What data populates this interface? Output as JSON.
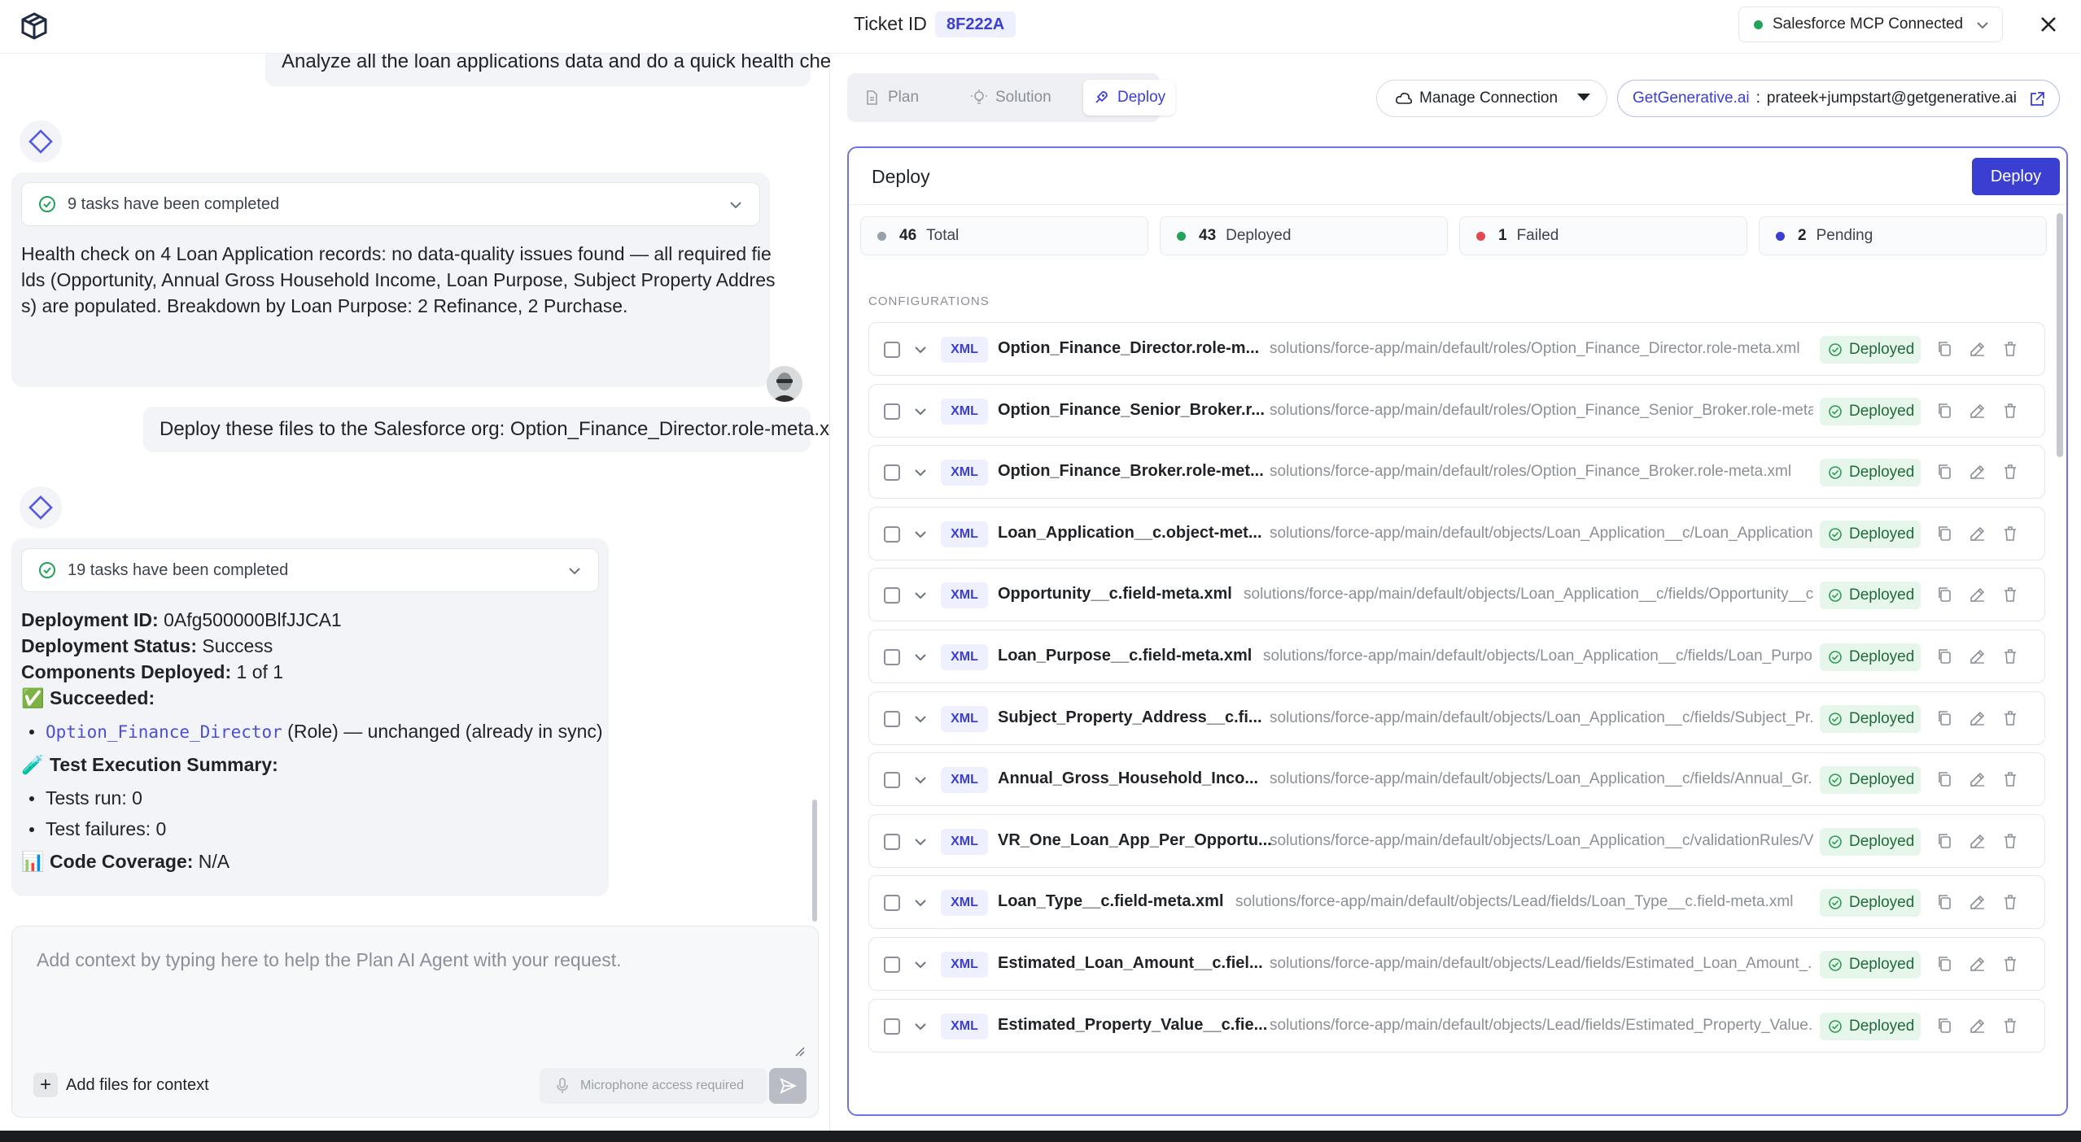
{
  "app": {
    "left": {
      "previous_user_message": "Analyze all the loan applications data and do a quick health check",
      "first_bot": {
        "tasks_label": "9 tasks have been completed",
        "text_lines": [
          "Health check on 4 Loan Application records: no data-quality issues found — all required fie",
          "lds (Opportunity, Annual Gross Household Income, Loan Purpose, Subject Property Addres",
          "s) are populated. Breakdown by Loan Purpose: 2 Refinance, 2 Purchase."
        ]
      },
      "user_message": "Deploy these files to the Salesforce org: Option_Finance_Director.role-meta.xml.",
      "second_bot": {
        "tasks_label": "19 tasks have been completed",
        "deployment_id_label": "Deployment ID:",
        "deployment_id_value": " 0Afg500000BlfJJCA1",
        "status_label": "Deployment Status:",
        "status_value": " Success",
        "components_label": "Components Deployed:",
        "components_value": " 1 of 1",
        "succeeded_emoji": "✅",
        "succeeded_label": "Succeeded:",
        "succeeded_item_code": "Option_Finance_Director",
        "succeeded_item_rest": " (Role) — unchanged (already in sync)",
        "test_emoji": "🧪",
        "test_label": "Test Execution Summary:",
        "tests_run": "Tests run: 0",
        "test_failures": "Test failures: 0",
        "coverage_emoji": "📊",
        "coverage_label": "Code Coverage:",
        "coverage_value": " N/A"
      },
      "composer": {
        "placeholder": "Add context by typing here to help the Plan AI Agent with your request.",
        "add_files_label": "Add files for context",
        "mic_label": "Microphone access required"
      }
    },
    "right": {
      "ticket_label": "Ticket ID",
      "ticket_id": "8F222A",
      "mcp_status": "Salesforce MCP Connected",
      "tabs": [
        {
          "label": "Plan",
          "active": false
        },
        {
          "label": "Solution",
          "active": false
        },
        {
          "label": "Deploy",
          "active": true
        }
      ],
      "manage_connection_label": "Manage Connection",
      "org_brand": "GetGenerative.ai",
      "org_separator": ":",
      "org_email": "prateek+jumpstart@getgenerative.ai",
      "panel_title": "Deploy",
      "deploy_button": "Deploy",
      "stats": [
        {
          "count": "46",
          "label": "Total",
          "color": "#9aa0a8"
        },
        {
          "count": "43",
          "label": "Deployed",
          "color": "#22a25a"
        },
        {
          "count": "1",
          "label": "Failed",
          "color": "#e5484d"
        },
        {
          "count": "2",
          "label": "Pending",
          "color": "#3b3fd1"
        }
      ],
      "configurations_label": "CONFIGURATIONS",
      "rows": [
        {
          "type": "XML",
          "name": "Option_Finance_Director.role-m...",
          "path": "solutions/force-app/main/default/roles/Option_Finance_Director.role-meta.xml",
          "status": "Deployed"
        },
        {
          "type": "XML",
          "name": "Option_Finance_Senior_Broker.r...",
          "path": "solutions/force-app/main/default/roles/Option_Finance_Senior_Broker.role-meta...",
          "status": "Deployed"
        },
        {
          "type": "XML",
          "name": "Option_Finance_Broker.role-met...",
          "path": "solutions/force-app/main/default/roles/Option_Finance_Broker.role-meta.xml",
          "status": "Deployed"
        },
        {
          "type": "XML",
          "name": "Loan_Application__c.object-met...",
          "path": "solutions/force-app/main/default/objects/Loan_Application__c/Loan_Application...",
          "status": "Deployed"
        },
        {
          "type": "XML",
          "name": "Opportunity__c.field-meta.xml",
          "path": "solutions/force-app/main/default/objects/Loan_Application__c/fields/Opportunity__c...",
          "status": "Deployed"
        },
        {
          "type": "XML",
          "name": "Loan_Purpose__c.field-meta.xml",
          "path": "solutions/force-app/main/default/objects/Loan_Application__c/fields/Loan_Purpo...",
          "status": "Deployed"
        },
        {
          "type": "XML",
          "name": "Subject_Property_Address__c.fi...",
          "path": "solutions/force-app/main/default/objects/Loan_Application__c/fields/Subject_Pr...",
          "status": "Deployed"
        },
        {
          "type": "XML",
          "name": "Annual_Gross_Household_Inco...",
          "path": "solutions/force-app/main/default/objects/Loan_Application__c/fields/Annual_Gr...",
          "status": "Deployed"
        },
        {
          "type": "XML",
          "name": "VR_One_Loan_App_Per_Opportu...",
          "path": "solutions/force-app/main/default/objects/Loan_Application__c/validationRules/V...",
          "status": "Deployed"
        },
        {
          "type": "XML",
          "name": "Loan_Type__c.field-meta.xml",
          "path": "solutions/force-app/main/default/objects/Lead/fields/Loan_Type__c.field-meta.xml",
          "status": "Deployed"
        },
        {
          "type": "XML",
          "name": "Estimated_Loan_Amount__c.fiel...",
          "path": "solutions/force-app/main/default/objects/Lead/fields/Estimated_Loan_Amount_...",
          "status": "Deployed"
        },
        {
          "type": "XML",
          "name": "Estimated_Property_Value__c.fie...",
          "path": "solutions/force-app/main/default/objects/Lead/fields/Estimated_Property_Value...",
          "status": "Deployed"
        }
      ]
    }
  }
}
